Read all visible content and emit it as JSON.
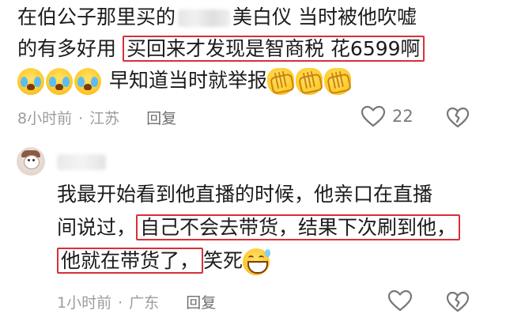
{
  "comment1": {
    "line1_before": "在伯公子那里买的",
    "line1_after": "美白仪 当时被他吹嘘",
    "line2_before": "的有多好用",
    "line2_highlight": "买回来才发现是智商税 花6599啊",
    "line3_text": "早知道当时就举报",
    "time": "8小时前",
    "location": "江苏",
    "reply_label": "回复",
    "like_count": "22",
    "emoji_before": [
      "loudly-crying-face",
      "loudly-crying-face",
      "loudly-crying-face"
    ],
    "emoji_after": [
      "clapping-hands",
      "clapping-hands",
      "clapping-hands"
    ]
  },
  "comment2": {
    "line1": "我最开始看到他直播的时候，他亲口在直播",
    "line2_before": "间说过，",
    "line2_highlight": "自己不会去带货，结果下次刷到他，",
    "line3_highlight": "他就在带货了，",
    "line3_after": "笑死",
    "time": "1小时前",
    "location": "广东",
    "reply_label": "回复",
    "emoji": "grinning-face-with-sweat"
  },
  "separator": "·",
  "colors": {
    "highlight_border": "#d7303a",
    "meta_text": "#9c9c9c",
    "body_text": "#1b1b1b"
  }
}
